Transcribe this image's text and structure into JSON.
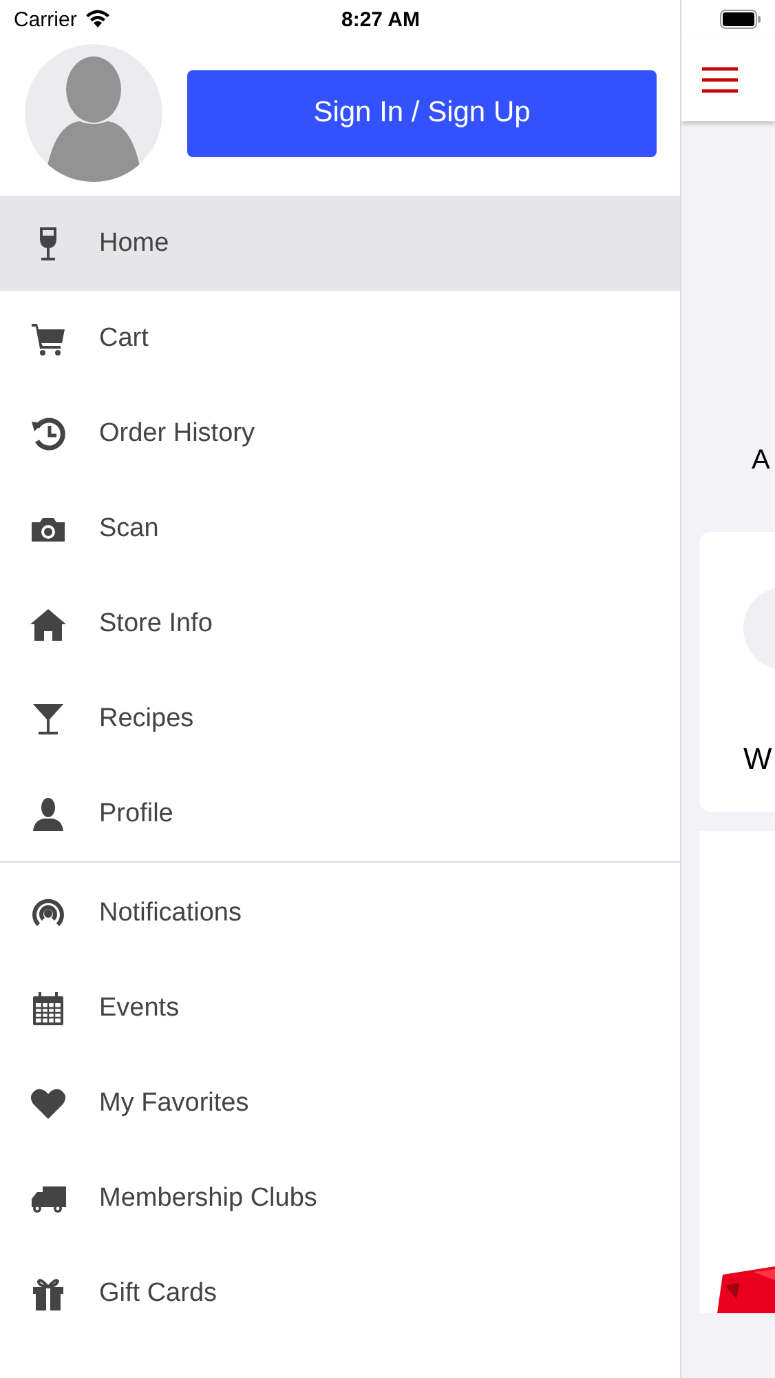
{
  "status_bar": {
    "carrier": "Carrier",
    "time": "8:27 AM"
  },
  "drawer": {
    "sign_in_button": "Sign In / Sign Up",
    "menu_sections": [
      [
        {
          "label": "Home",
          "selected": true
        },
        {
          "label": "Cart",
          "selected": false
        },
        {
          "label": "Order History",
          "selected": false
        },
        {
          "label": "Scan",
          "selected": false
        },
        {
          "label": "Store Info",
          "selected": false
        },
        {
          "label": "Recipes",
          "selected": false
        },
        {
          "label": "Profile",
          "selected": false
        }
      ],
      [
        {
          "label": "Notifications",
          "selected": false
        },
        {
          "label": "Events",
          "selected": false
        },
        {
          "label": "My Favorites",
          "selected": false
        },
        {
          "label": "Membership Clubs",
          "selected": false
        },
        {
          "label": "Gift Cards",
          "selected": false
        }
      ]
    ]
  },
  "background_page": {
    "text_1": "A",
    "card_text": "W"
  }
}
